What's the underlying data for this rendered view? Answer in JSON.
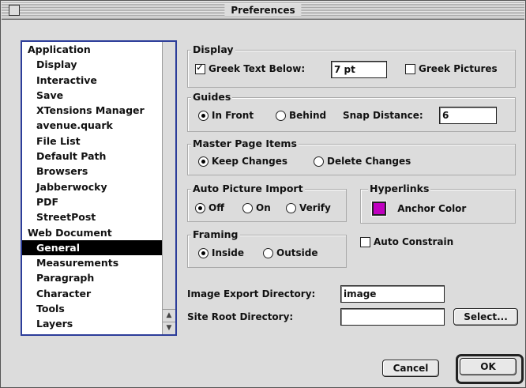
{
  "window": {
    "title": "Preferences"
  },
  "list": {
    "items": [
      {
        "label": "Application",
        "sub": false,
        "selected": false
      },
      {
        "label": "Display",
        "sub": true,
        "selected": false
      },
      {
        "label": "Interactive",
        "sub": true,
        "selected": false
      },
      {
        "label": "Save",
        "sub": true,
        "selected": false
      },
      {
        "label": "XTensions Manager",
        "sub": true,
        "selected": false
      },
      {
        "label": "avenue.quark",
        "sub": true,
        "selected": false
      },
      {
        "label": "File List",
        "sub": true,
        "selected": false
      },
      {
        "label": "Default Path",
        "sub": true,
        "selected": false
      },
      {
        "label": "Browsers",
        "sub": true,
        "selected": false
      },
      {
        "label": "Jabberwocky",
        "sub": true,
        "selected": false
      },
      {
        "label": "PDF",
        "sub": true,
        "selected": false
      },
      {
        "label": "StreetPost",
        "sub": true,
        "selected": false
      },
      {
        "label": "Web Document",
        "sub": false,
        "selected": false
      },
      {
        "label": "General",
        "sub": true,
        "selected": true
      },
      {
        "label": "Measurements",
        "sub": true,
        "selected": false
      },
      {
        "label": "Paragraph",
        "sub": true,
        "selected": false
      },
      {
        "label": "Character",
        "sub": true,
        "selected": false
      },
      {
        "label": "Tools",
        "sub": true,
        "selected": false
      },
      {
        "label": "Layers",
        "sub": true,
        "selected": false
      }
    ]
  },
  "display": {
    "title": "Display",
    "greek_text_label": "Greek Text Below:",
    "greek_text_checked": true,
    "greek_text_value": "7 pt",
    "greek_pictures_label": "Greek Pictures",
    "greek_pictures_checked": false
  },
  "guides": {
    "title": "Guides",
    "in_front_label": "In Front",
    "behind_label": "Behind",
    "selected": "In Front",
    "snap_label": "Snap Distance:",
    "snap_value": "6"
  },
  "master_page_items": {
    "title": "Master Page Items",
    "keep_label": "Keep Changes",
    "delete_label": "Delete Changes",
    "selected": "Keep Changes"
  },
  "auto_picture_import": {
    "title": "Auto Picture Import",
    "off_label": "Off",
    "on_label": "On",
    "verify_label": "Verify",
    "selected": "Off"
  },
  "hyperlinks": {
    "title": "Hyperlinks",
    "anchor_color_label": "Anchor Color",
    "anchor_color": "#c000c0"
  },
  "framing": {
    "title": "Framing",
    "inside_label": "Inside",
    "outside_label": "Outside",
    "selected": "Inside"
  },
  "auto_constrain": {
    "label": "Auto Constrain",
    "checked": false
  },
  "image_export": {
    "label": "Image Export Directory:",
    "value": "image"
  },
  "site_root": {
    "label": "Site Root Directory:",
    "value": "",
    "select_label": "Select..."
  },
  "buttons": {
    "cancel": "Cancel",
    "ok": "OK"
  }
}
